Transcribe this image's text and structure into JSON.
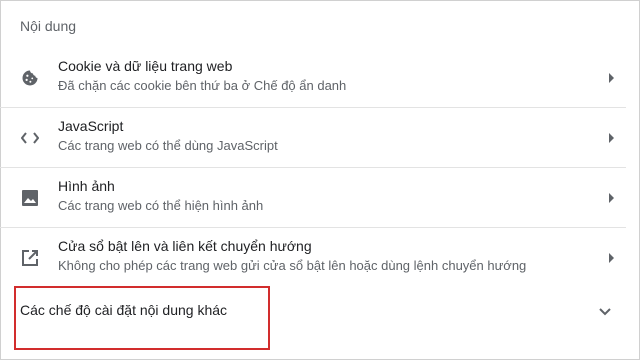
{
  "section": {
    "title": "Nội dung"
  },
  "rows": [
    {
      "label": "Cookie và dữ liệu trang web",
      "sublabel": "Đã chặn các cookie bên thứ ba ở Chế độ ẩn danh",
      "icon": "cookie-icon"
    },
    {
      "label": "JavaScript",
      "sublabel": "Các trang web có thể dùng JavaScript",
      "icon": "code-icon"
    },
    {
      "label": "Hình ảnh",
      "sublabel": "Các trang web có thể hiện hình ảnh",
      "icon": "image-icon"
    },
    {
      "label": "Cửa sổ bật lên và liên kết chuyển hướng",
      "sublabel": "Không cho phép các trang web gửi cửa sổ bật lên hoặc dùng lệnh chuyển hướng",
      "icon": "open-in-new-icon"
    }
  ],
  "advanced": {
    "label": "Các chế độ cài đặt nội dung khác",
    "icon": "chevron-down-icon"
  },
  "colors": {
    "highlight": "#d22d2d",
    "icon": "#5f6368",
    "divider": "#e3e3e3"
  }
}
